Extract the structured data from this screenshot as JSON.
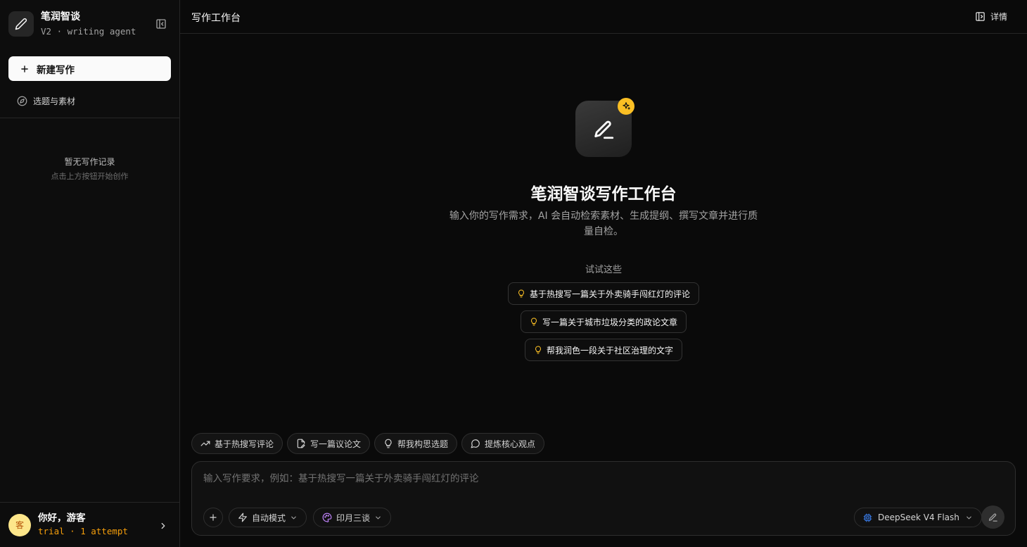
{
  "sidebar": {
    "brand_name": "笔润智谈",
    "brand_sub": "V2 · writing agent",
    "new_button": "新建写作",
    "topic_link": "选题与素材",
    "empty_title": "暂无写作记录",
    "empty_sub": "点击上方按钮开始创作",
    "user_name": "你好，游客",
    "user_plan": "trial · 1 attempt",
    "avatar_char": "客"
  },
  "topbar": {
    "title": "写作工作台",
    "details_label": "详情"
  },
  "hero": {
    "title": "笔润智谈写作工作台",
    "description": "输入你的写作需求，AI 会自动检索素材、生成提纲、撰写文章并进行质量自检。",
    "try_label": "试试这些",
    "suggestions": [
      "基于热搜写一篇关于外卖骑手闯红灯的评论",
      "写一篇关于城市垃圾分类的政论文章",
      "帮我润色一段关于社区治理的文字"
    ]
  },
  "chips": [
    {
      "label": "基于热搜写评论",
      "icon": "trending-up-icon"
    },
    {
      "label": "写一篇议论文",
      "icon": "file-pen-icon"
    },
    {
      "label": "帮我构思选题",
      "icon": "lightbulb-icon"
    },
    {
      "label": "提炼核心观点",
      "icon": "message-circle-icon"
    }
  ],
  "composer": {
    "placeholder": "输入写作要求，例如：基于热搜写一篇关于外卖骑手闯红灯的评论",
    "mode_label": "自动模式",
    "style_label": "印月三谈",
    "model_label": "DeepSeek V4 Flash"
  },
  "colors": {
    "accent_badge": "#fbbf24",
    "avatar_bg": "#fde68a",
    "plan_text": "#f59e0b",
    "model_icon": "#3b82f6",
    "style_icon": "#c084fc"
  }
}
